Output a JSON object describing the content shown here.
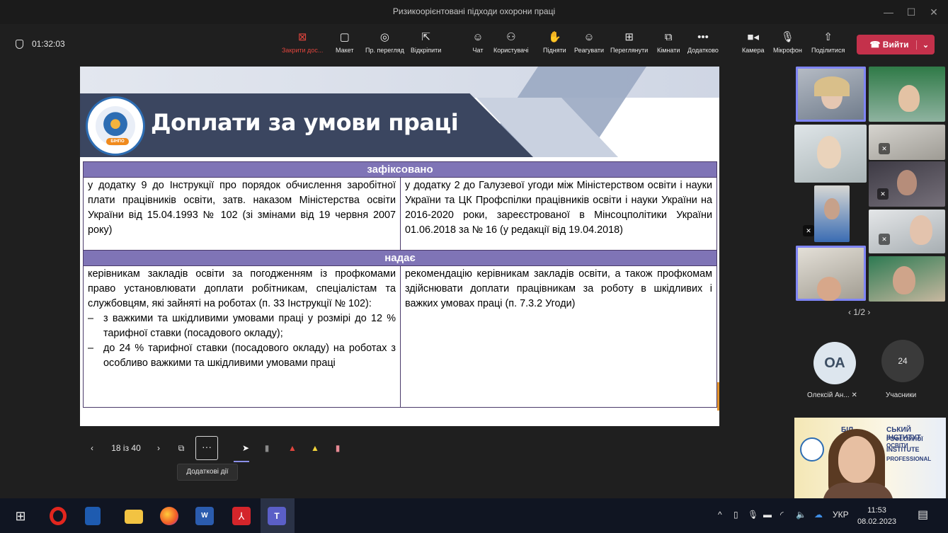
{
  "window": {
    "title": "Ризикоорієнтовані підходи охорони праці"
  },
  "meeting": {
    "elapsed": "01:32:03"
  },
  "toolbar": {
    "stop_share": "Закрити дос...",
    "layout": "Макет",
    "preview": "Пр. перегляд",
    "unpin": "Відкріпити",
    "chat": "Чат",
    "people": "Користувачі",
    "raise": "Підняти",
    "react": "Реагувати",
    "view": "Переглянути",
    "rooms": "Кімнати",
    "more": "Додатково",
    "camera": "Камера",
    "mic": "Мікрофон",
    "share": "Поділитися",
    "leave": "Вийти"
  },
  "slide": {
    "title": "Доплати за умови праці",
    "logo_badge": "БІНПО",
    "header1": "зафіксовано",
    "row1_left": "у додатку 9 до Інструкції про порядок обчислення заробітної плати працівників освіти, затв. наказом Міністерства освіти України від 15.04.1993 № 102 (зі змінами від 19 червня 2007 року)",
    "row1_right": "у додатку 2 до Галузевої угоди між Міністерством освіти і науки України та ЦК Профспілки працівників освіти і науки України на 2016-2020 роки, зареєстрованої в Мінсоцполітики України 01.06.2018 за № 16 (у редакції від 19.04.2018)",
    "header2": "надає",
    "row2_left_intro": "керівникам закладів освіти за погодженням із профкомами право установлювати доплати робітникам, спеціалістам та службовцям, які зайняті на роботах (п. 33 Інструкції № 102):",
    "row2_left_items": [
      "з важкими та шкідливими умовами праці у розмірі до 12 % тарифної ставки (посадового окладу);",
      "до 24 % тарифної ставки (посадового окладу) на роботах з особливо важкими та шкідливими умовами праці"
    ],
    "dash": "–",
    "row2_right": "рекомендацію керівникам закладів освіти, а також профкомам здійснювати доплати працівникам за роботу в шкідливих і важких умовах праці (п. 7.3.2 Угоди)"
  },
  "presenter_bar": {
    "page": "18 із 40",
    "more_tooltip": "Додаткові дії"
  },
  "gallery": {
    "pager": "1/2",
    "avatar_initials": "ОА",
    "avatar_name": "Олексій Ан...",
    "participants_count": "24",
    "participants_label": "Учасники"
  },
  "presenter_video": {
    "banner_line1": "БІЛ",
    "banner_line2": "СЬКИЙ ІНСТИТУТ",
    "banner_line3": "РОФЕСІЙНОЇ ОСВІТИ",
    "banner_line4": "INSTITUTE",
    "banner_line5": "PROFESSIONAL"
  },
  "taskbar": {
    "lang": "УКР",
    "time": "11:53",
    "date": "08.02.2023"
  },
  "colors": {
    "table_header": "#7f74b6",
    "slide_band": "#3b4660",
    "leave": "#c4314b",
    "active_tile": "#7f85f5"
  }
}
